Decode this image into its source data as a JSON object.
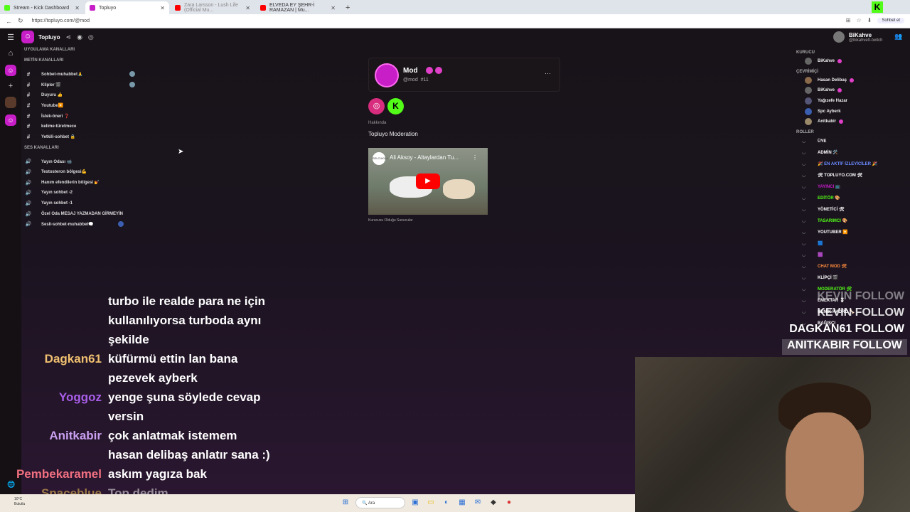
{
  "browser": {
    "tabs": [
      {
        "title": "Stream - Kick Dashboard",
        "color": "#53fc18"
      },
      {
        "title": "Topluyo",
        "color": "#c81ec8",
        "active": true
      },
      {
        "title": "Zara Larsson - Lush Life (Official Mu...",
        "color": "#ff0000"
      },
      {
        "title": "ELVEDA EY ŞEHR-İ RAMAZAN | Mu...",
        "color": "#ff0000"
      }
    ],
    "url": "https://topluyo.com/@mod",
    "chat_button": "Sohbet et"
  },
  "app": {
    "server_name": "Topluyo",
    "sections": {
      "app_channels": "UYGULAMA KANALLARI",
      "text_channels": "METİN KANALLARI",
      "voice_channels": "SES KANALLARI"
    },
    "text_channels": [
      "Sohbet-muhabbet🙏",
      "Klipler 🎬",
      "Duyuru 👍",
      "Youtube▶️",
      "İstek-öneri ❓",
      "kelime-türetmece",
      "Yetkili-sohbet 🔒"
    ],
    "voice_channels": [
      "Yayın Odası 📹",
      "Testosteron bölgesi💪",
      "Hanım efendilerin bölgesi 💅",
      "Yayın sohbet -2",
      "Yayın sohbet -1",
      "Özel Oda MESAJ YAZMADAN GİRMEYİN",
      "Sesli-sohbet-muhabbet🗨️"
    ]
  },
  "profile": {
    "name": "Mod",
    "handle": "@mod",
    "number": "#11",
    "about_label": "Hakkında",
    "about_text": "Topluyo Moderation",
    "video_title": "Ali Aksoy - Altaylardan Tu...",
    "video_caption": "Kurucusu Olduğu Sunucular"
  },
  "right_panel": {
    "user": {
      "name": "BiKahve",
      "handle": "@bikahve0-twitch"
    },
    "founder_label": "KURUCU",
    "founder": "BiKahve",
    "online_label": "ÇEVRİMİÇİ",
    "online": [
      "Hasan Delibaş",
      "BiKahve",
      "Yağızefe Hazar",
      "Spc Ayberk",
      "Anitkabir"
    ],
    "roles_label": "ROLLER",
    "roles": [
      {
        "name": "ÜYE",
        "color": "#ffffff"
      },
      {
        "name": "ADMİN 🛠️",
        "color": "#ffffff"
      },
      {
        "name": "🎉 EN AKTİF İZLEYİCİLER 🎉",
        "color": "#6b8cff"
      },
      {
        "name": "🛠 TOPLUYO.COM 🛠",
        "color": "#ffffff"
      },
      {
        "name": "YAYINCI 📺",
        "color": "#c81ec8"
      },
      {
        "name": "EDİTÖR 🎨",
        "color": "#53fc18"
      },
      {
        "name": "YÖNETİCİ 🛠",
        "color": "#ffffff"
      },
      {
        "name": "TASARIMCI 🎨",
        "color": "#53fc18"
      },
      {
        "name": "YOUTUBER ▶️",
        "color": "#ffffff"
      },
      {
        "name": "🟦",
        "color": "#3b82f6"
      },
      {
        "name": "🟪",
        "color": "#e040c8"
      },
      {
        "name": "CHAT MOD 🛠",
        "color": "#ff8a3d"
      },
      {
        "name": "KLİPÇİ 🎬",
        "color": "#ffffff"
      },
      {
        "name": "MODERATÖR 🛠",
        "color": "#53fc18"
      },
      {
        "name": "EMEKTAR 🎖",
        "color": "#ffffff"
      },
      {
        "name": "KEMİK KADRO 🦴",
        "color": "#ffffff"
      },
      {
        "name": "BAĞIŞÇI",
        "color": "#ffffff"
      }
    ]
  },
  "follows": [
    "KEVIN  FOLLOW",
    "KEVIN  FOLLOW",
    "DAGKAN61  FOLLOW",
    "ANITKABIR  FOLLOW"
  ],
  "chat": [
    {
      "user": "",
      "text": "turbo ile realde para ne için",
      "color": "#ffffff"
    },
    {
      "user": "",
      "text": "kullanılıyorsa turboda aynı",
      "color": "#ffffff"
    },
    {
      "user": "",
      "text": "şekilde",
      "color": "#ffffff"
    },
    {
      "user": "Dagkan61",
      "text": "küfürmü ettin lan bana",
      "color": "#f0c070"
    },
    {
      "user": "",
      "text": "pezevek ayberk",
      "color": "#ffffff"
    },
    {
      "user": "Yoggoz",
      "text": "yenge şuna söylede cevap",
      "color": "#a85ee8"
    },
    {
      "user": "",
      "text": "versin",
      "color": "#ffffff"
    },
    {
      "user": "Anitkabir",
      "text": "çok anlatmak istemem",
      "color": "#c9a0f0"
    },
    {
      "user": "",
      "text": "hasan delibaş anlatır sana :)",
      "color": "#ffffff"
    },
    {
      "user": "Pembekaramel",
      "text": "askım yagıza bak",
      "color": "#f07080"
    },
    {
      "user": "Spaceblue",
      "text": "Top dedim",
      "color": "#c8a050"
    }
  ],
  "taskbar": {
    "temp": "10°C",
    "weather": "Bulutlu",
    "search": "Ara"
  }
}
